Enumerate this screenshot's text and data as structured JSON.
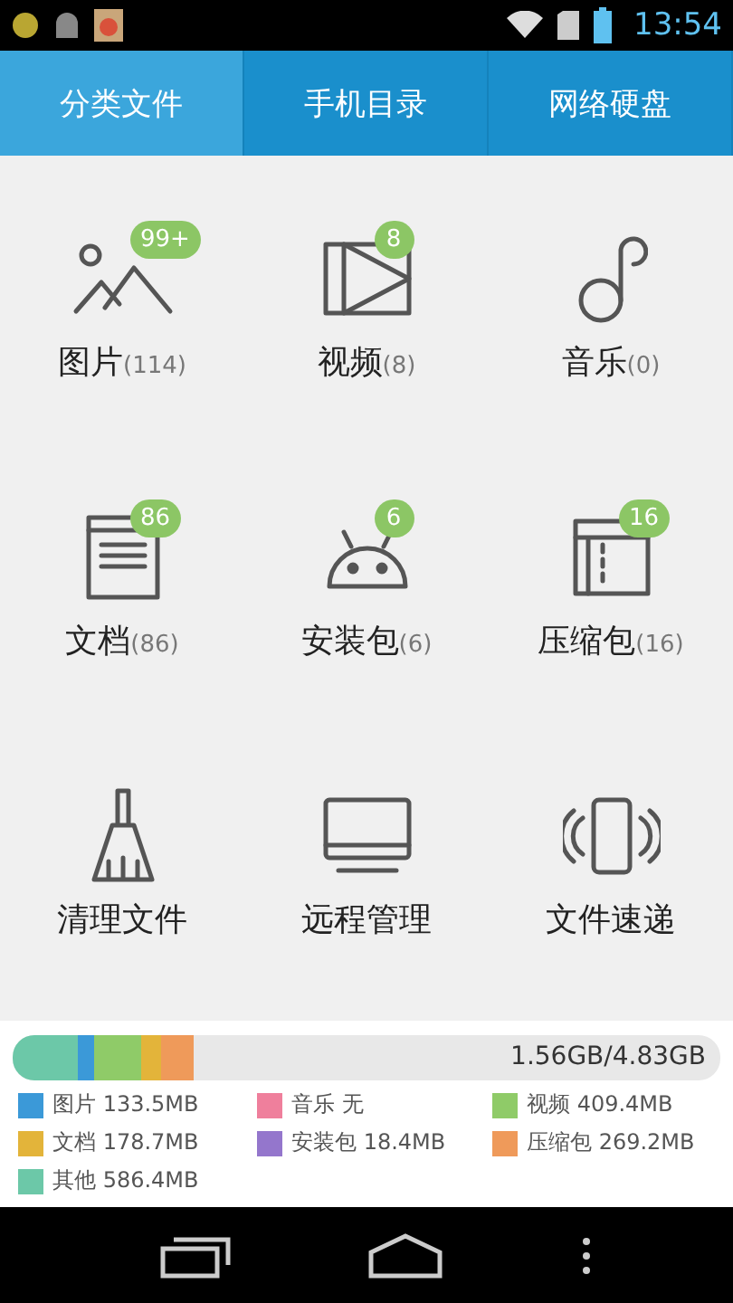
{
  "status_bar": {
    "time": "13:54"
  },
  "tabs": [
    {
      "label": "分类文件",
      "selected": true
    },
    {
      "label": "手机目录",
      "selected": false
    },
    {
      "label": "网络硬盘",
      "selected": false
    }
  ],
  "categories": [
    {
      "kind": "pictures",
      "name": "图片",
      "count": "(114)",
      "badge": "99+"
    },
    {
      "kind": "videos",
      "name": "视频",
      "count": "(8)",
      "badge": "8"
    },
    {
      "kind": "music",
      "name": "音乐",
      "count": "(0)"
    },
    {
      "kind": "documents",
      "name": "文档",
      "count": "(86)",
      "badge": "86"
    },
    {
      "kind": "apps",
      "name": "安装包",
      "count": "(6)",
      "badge": "6"
    },
    {
      "kind": "archives",
      "name": "压缩包",
      "count": "(16)",
      "badge": "16"
    },
    {
      "kind": "cleanup",
      "name": "清理文件"
    },
    {
      "kind": "remote",
      "name": "远程管理"
    },
    {
      "kind": "transfer",
      "name": "文件速递"
    }
  ],
  "storage": {
    "usage": "1.56GB/4.83GB",
    "segments": [
      {
        "color": "#6cc8a8"
      },
      {
        "color": "#3b99d8"
      },
      {
        "color": "#8fcb68"
      },
      {
        "color": "#e3b43a"
      },
      {
        "color": "#ef9a5a"
      }
    ],
    "legend": [
      {
        "label": "图片 133.5MB",
        "color": "#3b99d8"
      },
      {
        "label": "音乐 无",
        "color": "#ef7f9c"
      },
      {
        "label": "视频 409.4MB",
        "color": "#8fcb68"
      },
      {
        "label": "文档 178.7MB",
        "color": "#e3b43a"
      },
      {
        "label": "安装包 18.4MB",
        "color": "#9476cc"
      },
      {
        "label": "压缩包 269.2MB",
        "color": "#ef9a5a"
      },
      {
        "label": "其他 586.4MB",
        "color": "#6cc8a8"
      }
    ]
  }
}
